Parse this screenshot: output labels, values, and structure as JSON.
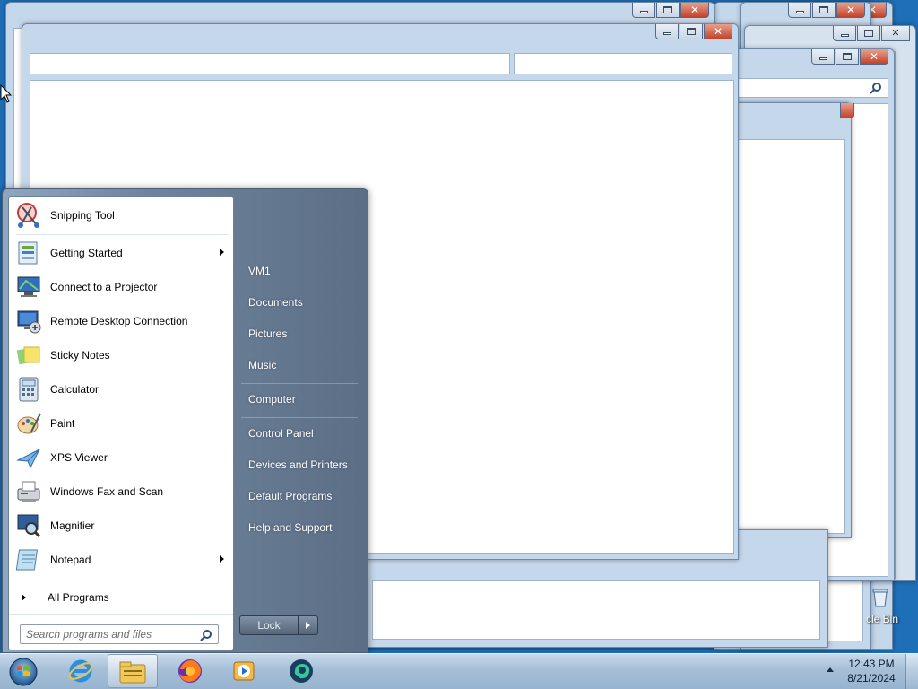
{
  "desktop": {
    "recycle_bin_label": "cle Bin"
  },
  "start_menu": {
    "programs": [
      {
        "label": "Snipping Tool",
        "icon": "snipping-tool-icon",
        "has_submenu": false
      },
      {
        "label": "Getting Started",
        "icon": "getting-started-icon",
        "has_submenu": true
      },
      {
        "label": "Connect to a Projector",
        "icon": "projector-icon",
        "has_submenu": false
      },
      {
        "label": "Remote Desktop Connection",
        "icon": "remote-desktop-icon",
        "has_submenu": false
      },
      {
        "label": "Sticky Notes",
        "icon": "sticky-notes-icon",
        "has_submenu": false
      },
      {
        "label": "Calculator",
        "icon": "calculator-icon",
        "has_submenu": false
      },
      {
        "label": "Paint",
        "icon": "paint-icon",
        "has_submenu": false
      },
      {
        "label": "XPS Viewer",
        "icon": "xps-viewer-icon",
        "has_submenu": false
      },
      {
        "label": "Windows Fax and Scan",
        "icon": "fax-scan-icon",
        "has_submenu": false
      },
      {
        "label": "Magnifier",
        "icon": "magnifier-icon",
        "has_submenu": false
      },
      {
        "label": "Notepad",
        "icon": "notepad-icon",
        "has_submenu": true
      }
    ],
    "all_programs_label": "All Programs",
    "search_placeholder": "Search programs and files",
    "right_links": [
      {
        "label": "VM1"
      },
      {
        "label": "Documents"
      },
      {
        "label": "Pictures"
      },
      {
        "label": "Music"
      },
      {
        "label": "Computer"
      },
      {
        "label": "Control Panel"
      },
      {
        "label": "Devices and Printers"
      },
      {
        "label": "Default Programs"
      },
      {
        "label": "Help and Support"
      }
    ],
    "lock_label": "Lock"
  },
  "taskbar": {
    "items": [
      {
        "name": "internet-explorer-icon",
        "active": false
      },
      {
        "name": "windows-explorer-icon",
        "active": true
      },
      {
        "name": "firefox-icon",
        "active": false
      },
      {
        "name": "media-player-icon",
        "active": false
      },
      {
        "name": "app-icon",
        "active": false
      }
    ],
    "clock_time": "12:43 PM",
    "clock_date": "8/21/2024"
  },
  "colors": {
    "desktop_bg": "#1f6fb8",
    "close_button": "#c4432b",
    "window_frame": "#c5d7ea"
  }
}
